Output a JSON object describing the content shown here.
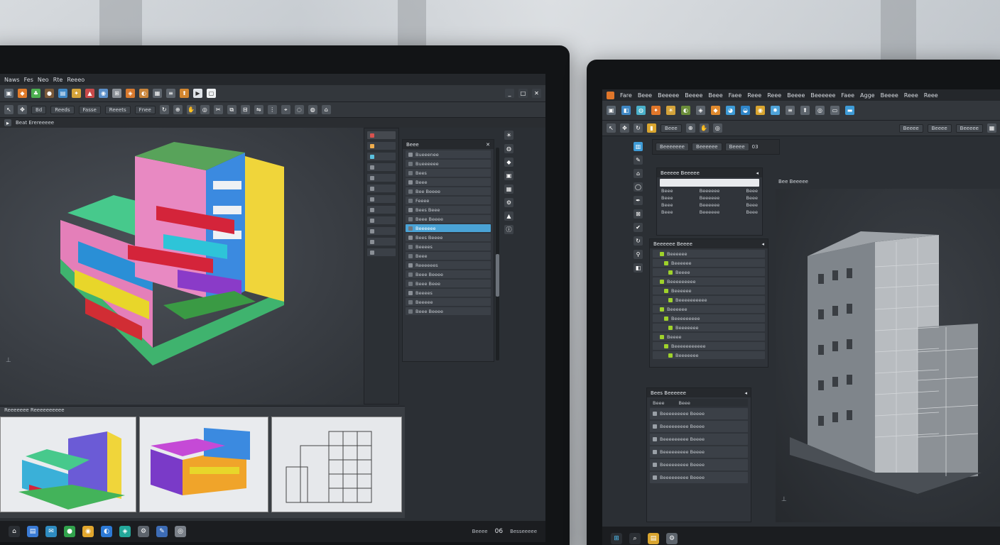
{
  "left": {
    "menu": [
      "Naws",
      "Fes",
      "Neo",
      "Rte",
      "Reeeo"
    ],
    "toolbar2_buttons": [
      "Bd",
      "Reeds",
      "Fasse",
      "Reeets",
      "Fnee"
    ],
    "viewport_tab": "Beat Erereeeee",
    "panel_head": "Beee",
    "panel_rows": [
      "Bueeenee",
      "Bueeeeee",
      "Bees",
      "Beee",
      "Bee Beeee",
      "Feeee",
      "Bees Beee",
      "Beee Beeee",
      "Beeeeee",
      "Bees Beeee",
      "Beeees",
      "Beee",
      "Reeeeees",
      "Beee Beeee",
      "Beee Beee",
      "Beeees",
      "Beeeee",
      "Beee Beeee"
    ],
    "selected_row_index": 8,
    "views_tab": "Reeeeeee Reeeeeeeeee",
    "tray_text": "Beeee",
    "tray_time": "06",
    "tray_date": "Besseeeee"
  },
  "right": {
    "menu": [
      "Fare",
      "Beee",
      "Beeeee",
      "Beeee",
      "Beee",
      "Faee",
      "Reee",
      "Reee",
      "Beeee",
      "Beeeeee",
      "Faee",
      "Agge",
      "Beeee",
      "Reee",
      "Reee"
    ],
    "toolbar2_buttons": [
      "Beee",
      "Beeee",
      "Beeee",
      "Beeeee"
    ],
    "tabs": [
      "Beeeeeee",
      "Beeeeee",
      "Beeee"
    ],
    "tab_count": "03",
    "viewport_tab": "Bee Beeeee",
    "prop_panel_title": "Beeeee Beeeee",
    "prop_rows": [
      [
        "Beee",
        "Beeeeee",
        "Beee"
      ],
      [
        "Beee",
        "Beeeeee",
        "Beee"
      ],
      [
        "Beee",
        "Beeeeee",
        "Beee"
      ],
      [
        "Beee",
        "Beeeeee",
        "Beee"
      ]
    ],
    "tree_panel_title": "Beeeeee Beeee",
    "tree_rows": [
      "Beeeeee",
      "Beeeeee",
      "Beeee",
      "Beeeeeeeee",
      "Beeeeee",
      "Beeeeeeeeee",
      "Beeeeee",
      "Beeeeeeeee",
      "Beeeeeee",
      "Beeee",
      "Beeeeeeeeeee",
      "Beeeeeee"
    ],
    "list_panel_title": "Bees Beeeeee",
    "list_header": [
      "Beee",
      "Beee"
    ],
    "list_rows": [
      "Beeeeeeeee Beeee",
      "Beeeeeeeee Beeee",
      "Beeeeeeeee Beeee",
      "Beeeeeeeee Beeee",
      "Beeeeeeeee Beeee",
      "Beeeeeeeee Beeee"
    ]
  },
  "colors": {
    "accent": "#4aa3d6",
    "bg_dark": "#2b2f34",
    "tree_green": "#9fd22b"
  }
}
